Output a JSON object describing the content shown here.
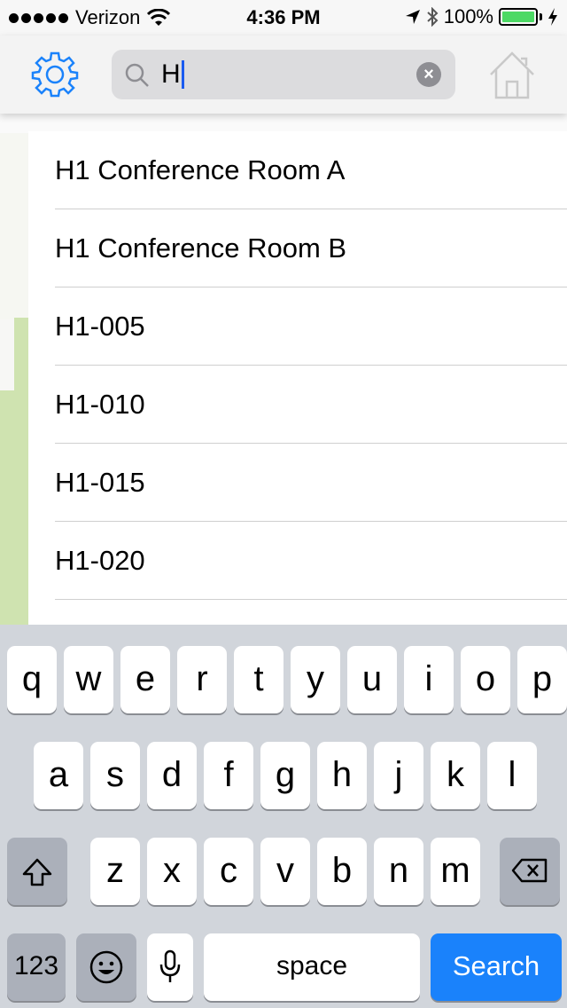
{
  "status_bar": {
    "carrier": "Verizon",
    "time": "4:36 PM",
    "battery": "100%",
    "battery_level": 1.0
  },
  "nav": {
    "settings_icon": "gear-icon",
    "home_icon": "home-icon",
    "search": {
      "value": "H",
      "icon": "search-icon"
    }
  },
  "results": [
    "H1 Conference Room A",
    "H1 Conference Room B",
    "H1-005",
    "H1-010",
    "H1-015",
    "H1-020"
  ],
  "keyboard": {
    "row1": [
      "q",
      "w",
      "e",
      "r",
      "t",
      "y",
      "u",
      "i",
      "o",
      "p"
    ],
    "row2": [
      "a",
      "s",
      "d",
      "f",
      "g",
      "h",
      "j",
      "k",
      "l"
    ],
    "row3": [
      "z",
      "x",
      "c",
      "v",
      "b",
      "n",
      "m"
    ],
    "numbers": "123",
    "space": "space",
    "search": "Search"
  },
  "colors": {
    "accent": "#1a82fb",
    "map_green": "#cfe3b0"
  }
}
